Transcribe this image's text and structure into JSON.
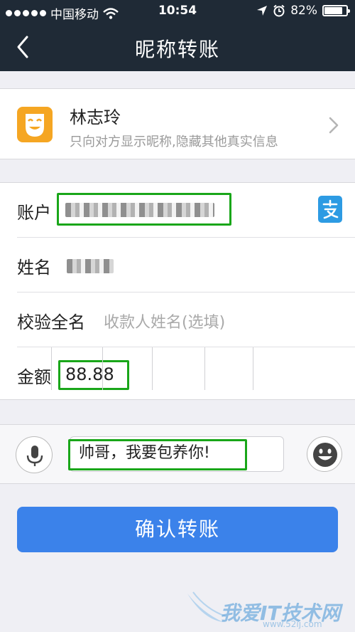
{
  "status_bar": {
    "carrier": "中国移动",
    "time": "10:54",
    "battery_percent": "82%",
    "battery_level": 0.82
  },
  "nav": {
    "title": "昵称转账"
  },
  "recipient": {
    "nickname": "林志玲",
    "subtitle": "只向对方显示昵称,隐藏其他真实信息"
  },
  "form": {
    "account_label": "账户",
    "name_label": "姓名",
    "verify_label": "校验全名",
    "verify_placeholder": "收款人姓名(选填)",
    "amount_label": "金额",
    "amount_value": "88.88"
  },
  "message": {
    "text": "帅哥，我要包养你!"
  },
  "confirm_button": {
    "label": "确认转账"
  },
  "watermark": {
    "text": "我爱IT技术网",
    "url": "www.52ij.com"
  },
  "colors": {
    "nav_bg": "#1f2a36",
    "primary_button": "#3b82ea",
    "highlight_box": "#19a619",
    "avatar_bg": "#f5a623",
    "alipay_icon_bg": "#2d9be3"
  },
  "icons": [
    "back-arrow-icon",
    "chevron-right-icon",
    "alipay-icon",
    "microphone-icon",
    "smiley-face-icon",
    "signal-dots-icon",
    "wifi-icon",
    "location-arrow-icon",
    "alarm-clock-icon",
    "battery-icon"
  ]
}
